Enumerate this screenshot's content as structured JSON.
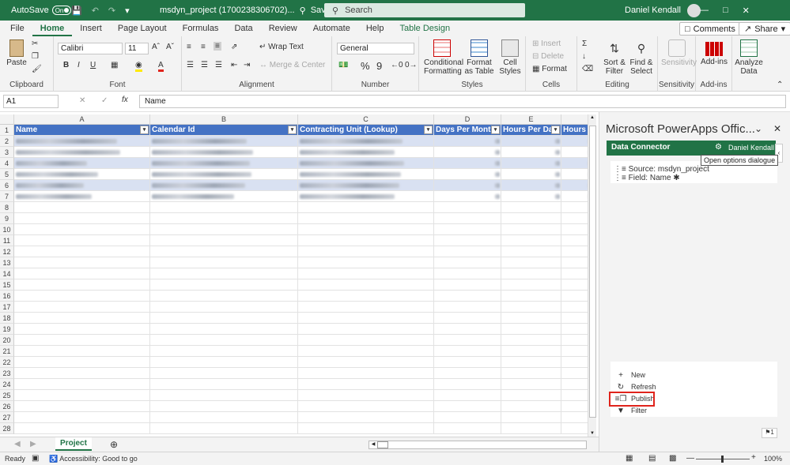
{
  "titlebar": {
    "autosave_label": "AutoSave",
    "autosave_state": "On",
    "filename": "msdyn_project (1700238306702)...",
    "saved_status": "Saved",
    "search_placeholder": "Search",
    "user_name": "Daniel Kendall"
  },
  "menu": {
    "tabs": [
      "File",
      "Home",
      "Insert",
      "Page Layout",
      "Formulas",
      "Data",
      "Review",
      "Automate",
      "Help",
      "Table Design"
    ],
    "active_tab": "Home",
    "comments_label": "Comments",
    "share_label": "Share"
  },
  "ribbon": {
    "clipboard": {
      "paste": "Paste",
      "label": "Clipboard"
    },
    "font": {
      "name": "Calibri",
      "size": "11",
      "label": "Font",
      "bold": "B",
      "italic": "I",
      "underline": "U"
    },
    "alignment": {
      "wrap": "Wrap Text",
      "merge": "Merge & Center",
      "label": "Alignment"
    },
    "number": {
      "format": "General",
      "percent": "%",
      "comma": "9",
      "label": "Number"
    },
    "styles": {
      "conditional": "Conditional Formatting",
      "format_table": "Format as Table",
      "cell_styles": "Cell Styles",
      "label": "Styles"
    },
    "cells": {
      "insert": "Insert",
      "delete": "Delete",
      "format": "Format",
      "label": "Cells"
    },
    "editing": {
      "sort": "Sort & Filter",
      "find": "Find & Select",
      "label": "Editing"
    },
    "sensitivity": {
      "button": "Sensitivity",
      "label": "Sensitivity"
    },
    "addins": {
      "button": "Add-ins",
      "label": "Add-ins"
    },
    "analyze": {
      "button": "Analyze Data"
    }
  },
  "formula_bar": {
    "cell_ref": "A1",
    "fx": "fx",
    "content": "Name"
  },
  "grid": {
    "columns": [
      "A",
      "B",
      "C",
      "D",
      "E"
    ],
    "headers": [
      "Name",
      "Calendar Id",
      "Contracting Unit (Lookup)",
      "Days Per Month",
      "Hours Per Day",
      "Hours"
    ],
    "row_numbers": [
      "1",
      "2",
      "3",
      "4",
      "5",
      "6",
      "7",
      "8",
      "9",
      "10",
      "11",
      "12",
      "13",
      "14",
      "15",
      "16",
      "17",
      "18",
      "19",
      "20",
      "21",
      "22",
      "23",
      "24",
      "25",
      "26",
      "27",
      "28"
    ]
  },
  "sheet": {
    "tab": "Project"
  },
  "status": {
    "ready": "Ready",
    "accessibility": "Accessibility: Good to go",
    "zoom": "100%"
  },
  "pane": {
    "title": "Microsoft PowerApps Offic...",
    "connector": "Data Connector",
    "user": "Daniel Kendall",
    "tooltip": "Open options dialogue",
    "source": "Source: msdyn_project",
    "field": "Field: Name",
    "actions": [
      "New",
      "Refresh",
      "Publish",
      "Filter"
    ]
  }
}
